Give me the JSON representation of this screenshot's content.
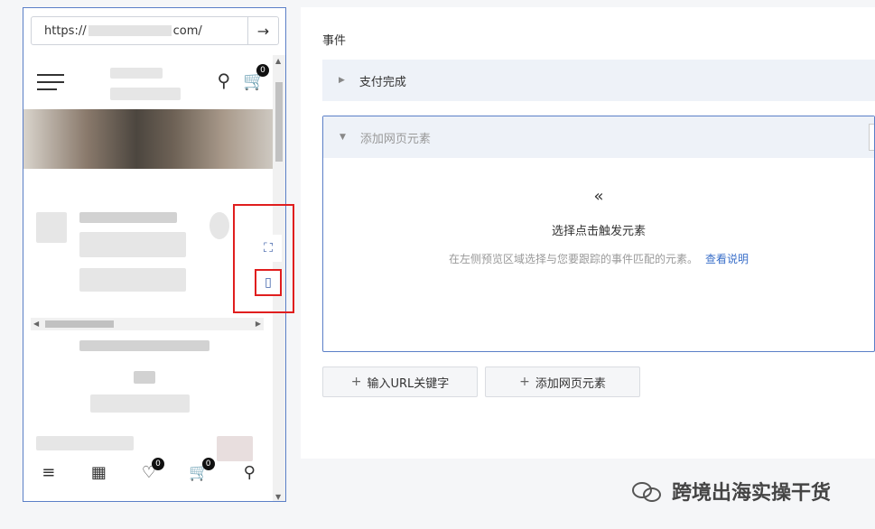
{
  "preview": {
    "url_prefix": "https://",
    "url_suffix": "com/",
    "go_icon": "→",
    "cart_badge_top": "0",
    "wishlist_badge": "0",
    "cart_badge_bottom": "0"
  },
  "tools": {
    "select_icon": "⛶",
    "layout_icon": "▯"
  },
  "events": {
    "section_label": "事件",
    "collapsed_item": "支付完成",
    "expanded_item": "添加网页元素",
    "chevron": "«",
    "empty_title": "选择点击触发元素",
    "empty_desc": "在左侧预览区域选择与您要跟踪的事件匹配的元素。",
    "help_link": "查看说明"
  },
  "actions": {
    "add_url_keyword": "输入URL关键字",
    "add_page_element": "添加网页元素"
  },
  "watermark": "跨境出海实操干货"
}
